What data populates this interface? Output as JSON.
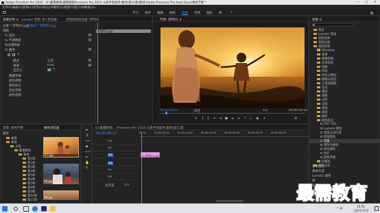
{
  "window": {
    "title": "Adobe Premiere Pro 2020 - D:\\最需教育\\最需教育Premiere Pro 2020 从新手到高手\\素材\\第12章\\素材\\Adobe Premiere Pro Auto-Save\\调色节奏 *",
    "controls": {
      "minimize": "—",
      "maximize": "▢",
      "close": "✕"
    }
  },
  "menu": [
    "文件(F)",
    "编辑(E)",
    "剪辑(C)",
    "序列(S)",
    "标记(M)",
    "图形(G)",
    "视图(V)",
    "窗口(W)",
    "帮助(H)"
  ],
  "workspaces": {
    "items": [
      "学习",
      "组件",
      "编辑",
      "颜色",
      "效果",
      "音频",
      "图形",
      "库"
    ],
    "active": "效果"
  },
  "effect_controls": {
    "tabs": [
      "效果控件 ≡",
      "Lumetri 范围",
      "源:(无剪辑)",
      "音频剪辑混合器: 序列01"
    ],
    "source": "主要 * 序列01.jpg",
    "sequence": "序列01 * 序列01.jpg",
    "clip_badge": "序列01.jpg",
    "groups": [
      {
        "label": "视频",
        "indent": 0
      },
      {
        "label": "fx 运动",
        "indent": 1
      },
      {
        "label": "fx 不透明度",
        "indent": 1
      },
      {
        "label": "时间重映射",
        "indent": 1
      },
      {
        "label": "fx 曲线",
        "indent": 1
      }
    ],
    "properties": [
      {
        "label": "模式",
        "value": "正常"
      },
      {
        "label": "通道",
        "value": "RGB"
      },
      {
        "label": "自定义",
        "value": "✎"
      }
    ],
    "sub_items": [
      "重置参数",
      "颜色调整",
      "颜色校正",
      "混合参数",
      "颜色替换"
    ]
  },
  "program_monitor": {
    "tab": "节目: 序列01 ≡",
    "timecode_left": "00:00:00:11",
    "fit": "适合",
    "ratio": "1/2",
    "timecode_right": "00:00:02:00"
  },
  "project": {
    "tabs": [
      "项目: 调色节奏",
      "媒体浏览器",
      "信息",
      "效果",
      "标记"
    ],
    "active_tab": "媒体浏览器",
    "left_label": "最近",
    "tree": [
      "桌面",
      "本地",
      "文档",
      "最需教育",
      "素材",
      "第1章",
      "第2章",
      "第3章",
      "第4章",
      "第5章",
      "第6章",
      "第7章",
      "第8章",
      "第9章",
      "第10章",
      "第11章",
      "第12章"
    ],
    "thumbnails": [
      {
        "name": "07.jpg",
        "duration": ""
      },
      {
        "name": "08.jpg",
        "duration": ""
      },
      {
        "name": "09.jpg",
        "duration": ""
      }
    ]
  },
  "timeline": {
    "tab": "序列01 ≡",
    "path_label": "D:\\最需教育\\...\\Premiere Pro 2020 从新手到高手\\素材\\第12章",
    "timecode": "00:00:00:11",
    "ruler": [
      "00:00",
      "00:00:05:00",
      "00:00:10:00",
      "00:00:15:00",
      "00:00:20:00",
      "00:00:25:00",
      "00:00:30:00"
    ],
    "tracks": [
      "V3",
      "V2",
      "V1",
      "A1",
      "A2",
      "A3",
      "主声道"
    ],
    "master_value": "0.0",
    "clip_label": "fx 序列01.jpg"
  },
  "effects_panel": {
    "title": "效果 ≡",
    "items": [
      {
        "label": "预设",
        "indent": 0,
        "hl": false
      },
      {
        "label": "Lumetri 预设",
        "indent": 0,
        "hl": false
      },
      {
        "label": "音频效果",
        "indent": 0,
        "hl": false
      },
      {
        "label": "音频过渡",
        "indent": 0,
        "hl": false
      },
      {
        "label": "视频效果",
        "indent": 0,
        "hl": false
      },
      {
        "label": "Obsolete",
        "indent": 1,
        "hl": false
      },
      {
        "label": "变换",
        "indent": 1,
        "hl": false
      },
      {
        "label": "图像控制",
        "indent": 1,
        "hl": false
      },
      {
        "label": "实用程序",
        "indent": 1,
        "hl": false
      },
      {
        "label": "扭曲",
        "indent": 1,
        "hl": false
      },
      {
        "label": "时间",
        "indent": 1,
        "hl": false
      },
      {
        "label": "杂色与颗粒",
        "indent": 1,
        "hl": false
      },
      {
        "label": "模糊与锐化",
        "indent": 1,
        "hl": false
      },
      {
        "label": "沉浸式视频",
        "indent": 1,
        "hl": false
      },
      {
        "label": "生成",
        "indent": 1,
        "hl": false
      },
      {
        "label": "视频",
        "indent": 1,
        "hl": false
      },
      {
        "label": "调整",
        "indent": 1,
        "hl": false
      },
      {
        "label": "过时",
        "indent": 1,
        "hl": false
      },
      {
        "label": "过渡",
        "indent": 1,
        "hl": false
      },
      {
        "label": "透视",
        "indent": 1,
        "hl": false
      },
      {
        "label": "通道",
        "indent": 1,
        "hl": false
      },
      {
        "label": "键控",
        "indent": 1,
        "hl": false
      },
      {
        "label": "颜色校正",
        "indent": 1,
        "hl": false
      },
      {
        "label": "ASC CDL",
        "indent": 2,
        "hl": false
      },
      {
        "label": "Lumetri 颜色",
        "indent": 2,
        "hl": false
      },
      {
        "label": "亮度与对比度",
        "indent": 2,
        "hl": false
      },
      {
        "label": "保留颜色",
        "indent": 2,
        "hl": false
      },
      {
        "label": "均衡",
        "indent": 2,
        "hl": true
      },
      {
        "label": "更改为颜色",
        "indent": 2,
        "hl": false
      },
      {
        "label": "更改颜色",
        "indent": 2,
        "hl": false
      },
      {
        "label": "色彩",
        "indent": 2,
        "hl": false
      },
      {
        "label": "颜色平衡",
        "indent": 2,
        "hl": false
      },
      {
        "label": "风格化",
        "indent": 1,
        "hl": false
      },
      {
        "label": "视频过渡",
        "indent": 0,
        "hl": false
      }
    ],
    "bottom": [
      "基本图形",
      "基本声音",
      "Lumetri 颜色",
      "库",
      "标记",
      "历史记录",
      "信息"
    ]
  },
  "watermark": "最需教育",
  "taskbar": {
    "time": "15:52",
    "date": "2021/7/12",
    "tray": "^ 中"
  }
}
